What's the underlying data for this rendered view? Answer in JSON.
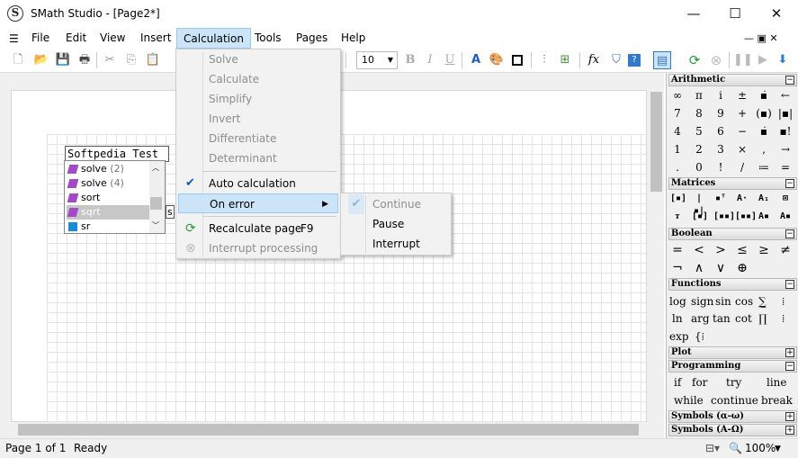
{
  "window": {
    "title": "SMath Studio - [Page2*]",
    "icon": "S",
    "minimize": "—",
    "maximize": "☐",
    "close": "✕"
  },
  "menubar": [
    "File",
    "Edit",
    "View",
    "Insert",
    "Calculation",
    "Tools",
    "Pages",
    "Help"
  ],
  "mdi_controls": "— ▣ ✕",
  "toolbar": {
    "font_size": "10",
    "bold": "B",
    "italic": "I",
    "underline": "U",
    "fx": "fx"
  },
  "document": {
    "input_text": "Softpedia Test",
    "tooltip_fragment": "s"
  },
  "autocomplete": [
    {
      "label": "solve",
      "count": "(2)"
    },
    {
      "label": "solve",
      "count": "(4)"
    },
    {
      "label": "sort",
      "count": ""
    },
    {
      "label": "sqrt",
      "count": ""
    },
    {
      "label": "sr",
      "count": ""
    }
  ],
  "calculation_menu": {
    "solve": "Solve",
    "calculate": "Calculate",
    "simplify": "Simplify",
    "invert": "Invert",
    "differentiate": "Differentiate",
    "determinant": "Determinant",
    "auto_calculation": "Auto calculation",
    "on_error": "On error",
    "recalculate": "Recalculate page",
    "recalculate_shortcut": "F9",
    "interrupt": "Interrupt processing"
  },
  "on_error_submenu": {
    "continue": "Continue",
    "pause": "Pause",
    "interrupt": "Interrupt"
  },
  "panels": {
    "arithmetic": {
      "title": "Arithmetic",
      "rows": [
        [
          "∞",
          "π",
          "i",
          "±",
          "▪̇",
          "←"
        ],
        [
          "7",
          "8",
          "9",
          "+",
          "(▪)",
          "|▪|"
        ],
        [
          "4",
          "5",
          "6",
          "−",
          "▪̇",
          "▪!"
        ],
        [
          "1",
          "2",
          "3",
          "×",
          "‚",
          "→"
        ],
        [
          ".",
          "0",
          "!",
          "/",
          "≔",
          "="
        ]
      ]
    },
    "matrices": {
      "title": "Matrices"
    },
    "boolean": {
      "title": "Boolean",
      "row1": [
        "=",
        "<",
        ">",
        "≤",
        "≥",
        "≠"
      ],
      "row2": [
        "¬",
        "∧",
        "∨",
        "⊕"
      ]
    },
    "functions": {
      "title": "Functions",
      "row1": [
        "log",
        "sign",
        "sin",
        "cos"
      ],
      "row2": [
        "ln",
        "arg",
        "tan",
        "cot"
      ],
      "row3": [
        "exp"
      ]
    },
    "plot": {
      "title": "Plot"
    },
    "programming": {
      "title": "Programming",
      "row1": [
        "if",
        "for",
        "try",
        "line"
      ],
      "row2": [
        "while",
        "continue",
        "break"
      ]
    },
    "symbols_greek_lower": {
      "title": "Symbols (α-ω)"
    },
    "symbols_greek_upper": {
      "title": "Symbols (Α-Ω)"
    }
  },
  "statusbar": {
    "page": "Page 1 of 1",
    "state": "Ready",
    "zoom": "100%"
  }
}
